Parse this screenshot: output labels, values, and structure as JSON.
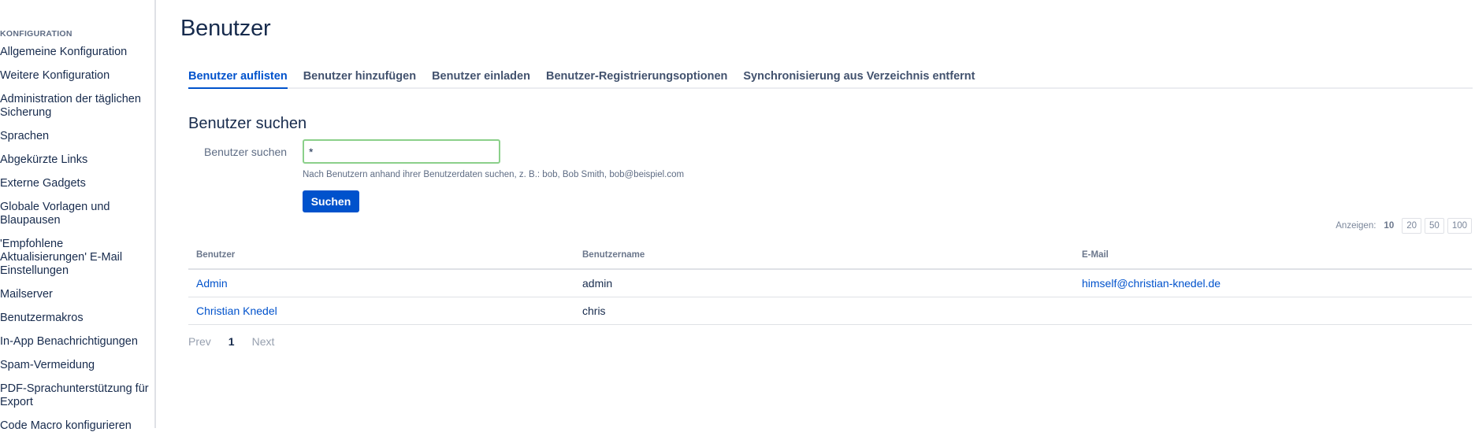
{
  "sidebar": {
    "heading": "KONFIGURATION",
    "items": [
      "Allgemeine Konfiguration",
      "Weitere Konfiguration",
      "Administration der täglichen Sicherung",
      "Sprachen",
      "Abgekürzte Links",
      "Externe Gadgets",
      "Globale Vorlagen und Blaupausen",
      "'Empfohlene Aktualisierungen' E-Mail Einstellungen",
      "Mailserver",
      "Benutzermakros",
      "In-App Benachrichtigungen",
      "Spam-Vermeidung",
      "PDF-Sprachunterstützung für Export",
      "Code Macro konfigurieren"
    ]
  },
  "page": {
    "title": "Benutzer"
  },
  "tabs": [
    "Benutzer auflisten",
    "Benutzer hinzufügen",
    "Benutzer einladen",
    "Benutzer-Registrierungsoptionen",
    "Synchronisierung aus Verzeichnis entfernt"
  ],
  "search": {
    "heading": "Benutzer suchen",
    "label": "Benutzer suchen",
    "value": "*",
    "help": "Nach Benutzern anhand ihrer Benutzerdaten suchen, z. B.: bob, Bob Smith, bob@beispiel.com",
    "button": "Suchen"
  },
  "pagesize": {
    "label": "Anzeigen:",
    "current": "10",
    "options": [
      "20",
      "50",
      "100"
    ]
  },
  "table": {
    "headers": [
      "Benutzer",
      "Benutzername",
      "E-Mail"
    ],
    "rows": [
      {
        "name": "Admin",
        "username": "admin",
        "email": "himself@christian-knedel.de"
      },
      {
        "name": "Christian Knedel",
        "username": "chris",
        "email": ""
      }
    ]
  },
  "pager": {
    "prev": "Prev",
    "current": "1",
    "next": "Next"
  }
}
